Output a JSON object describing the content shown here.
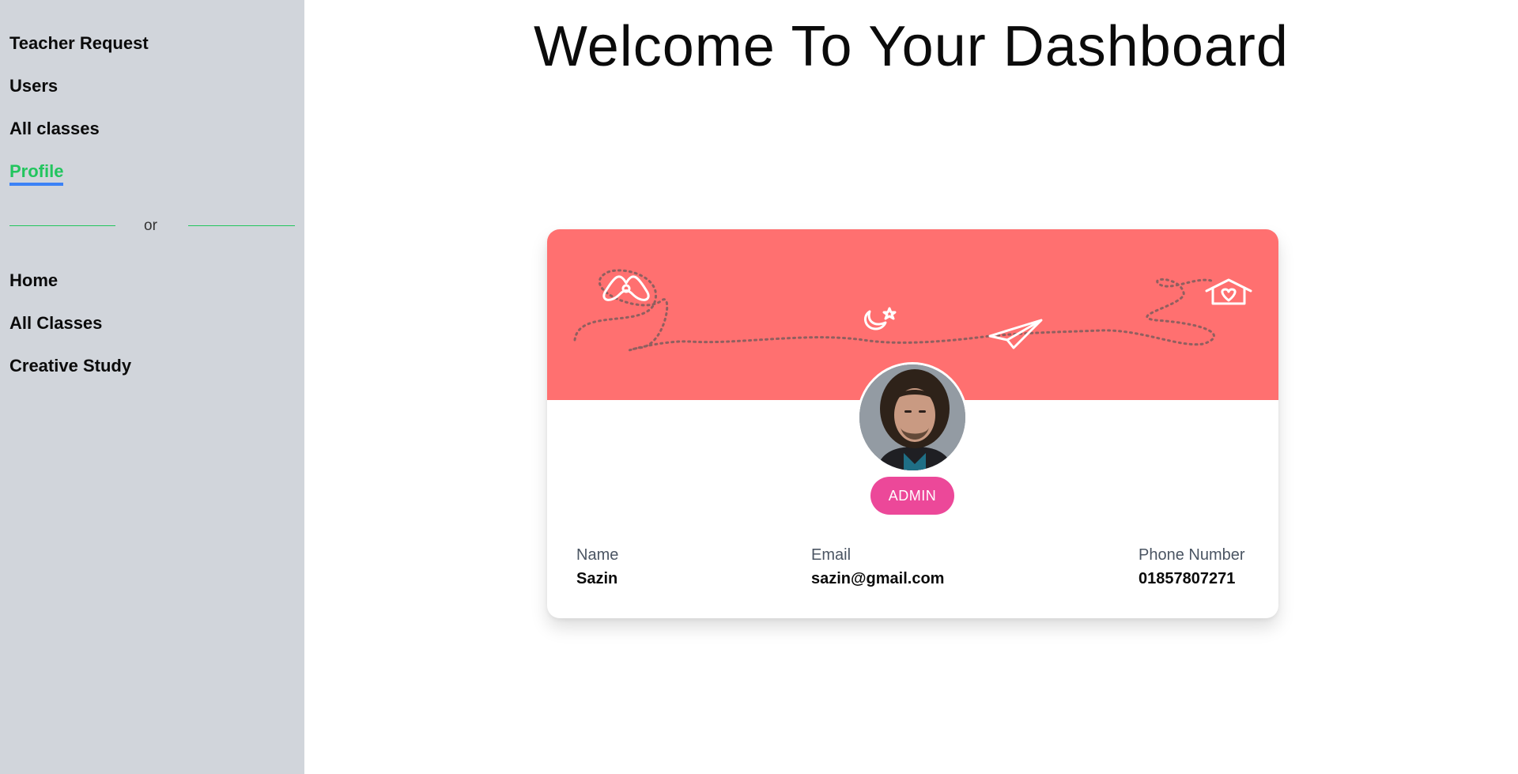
{
  "sidebar": {
    "dashboard_items": [
      {
        "label": "Teacher Request"
      },
      {
        "label": "Users"
      },
      {
        "label": "All classes"
      },
      {
        "label": "Profile",
        "active": true
      }
    ],
    "divider_text": "or",
    "site_items": [
      {
        "label": "Home"
      },
      {
        "label": "All Classes"
      },
      {
        "label": "Creative Study"
      }
    ]
  },
  "main": {
    "title": "Welcome To Your Dashboard"
  },
  "profile": {
    "cover_icons": [
      "airbnb-logo-icon",
      "moon-star-icon",
      "paper-plane-icon",
      "house-heart-icon"
    ],
    "avatar_icon": "user-avatar",
    "role": "ADMIN",
    "fields": {
      "name": {
        "label": "Name",
        "value": "Sazin"
      },
      "email": {
        "label": "Email",
        "value": "sazin@gmail.com"
      },
      "phone": {
        "label": "Phone Number",
        "value": "01857807271"
      }
    }
  },
  "colors": {
    "sidebar_bg": "#d1d5db",
    "active_link": "#22c55e",
    "active_underline": "#3b82f6",
    "divider": "#22c55e",
    "cover_bg": "#ff7070",
    "role_badge": "#ec4899"
  }
}
